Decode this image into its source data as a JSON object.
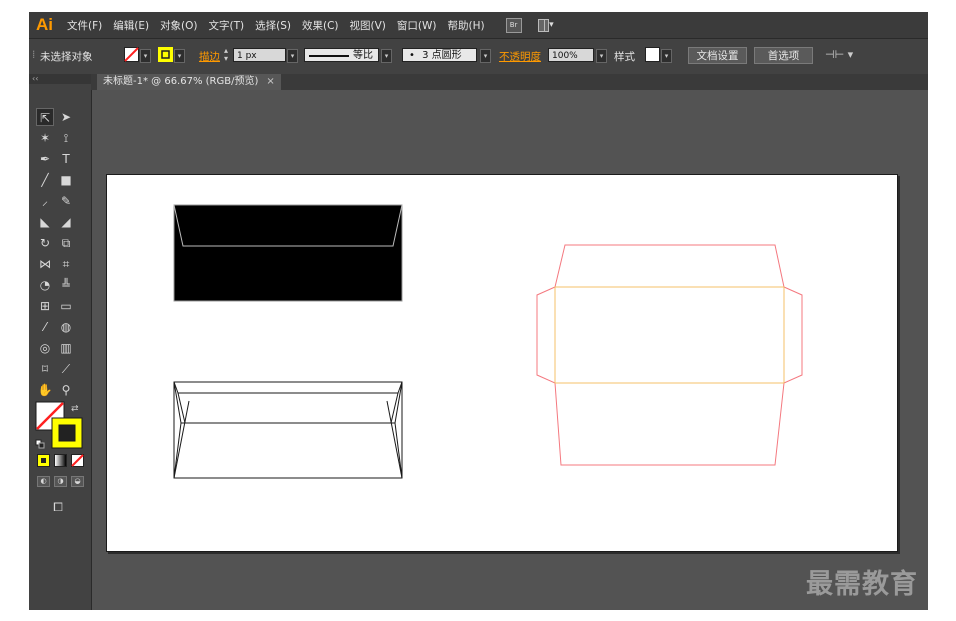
{
  "app": {
    "logo": "Ai"
  },
  "menu": [
    "文件(F)",
    "编辑(E)",
    "对象(O)",
    "文字(T)",
    "选择(S)",
    "效果(C)",
    "视图(V)",
    "窗口(W)",
    "帮助(H)"
  ],
  "menu_icons": {
    "bridge": "Br"
  },
  "control": {
    "selection_status": "未选择对象",
    "stroke_label": "描边",
    "stroke_value": "1 px",
    "profile_label": "等比",
    "brush_label": "3 点圆形",
    "opacity_label": "不透明度",
    "opacity_value": "100%",
    "style_label": "样式",
    "doc_setup_button": "文档设置",
    "preferences_button": "首选项"
  },
  "colors": {
    "fill": "#ff2020",
    "stroke": "#ffff00",
    "accent": "#ff9a00"
  },
  "tools_panel": {
    "collapse": "‹‹"
  },
  "document_tab": {
    "title": "未标题-1* @ 66.67% (RGB/预览)",
    "close": "×"
  },
  "watermark": "最需教育"
}
